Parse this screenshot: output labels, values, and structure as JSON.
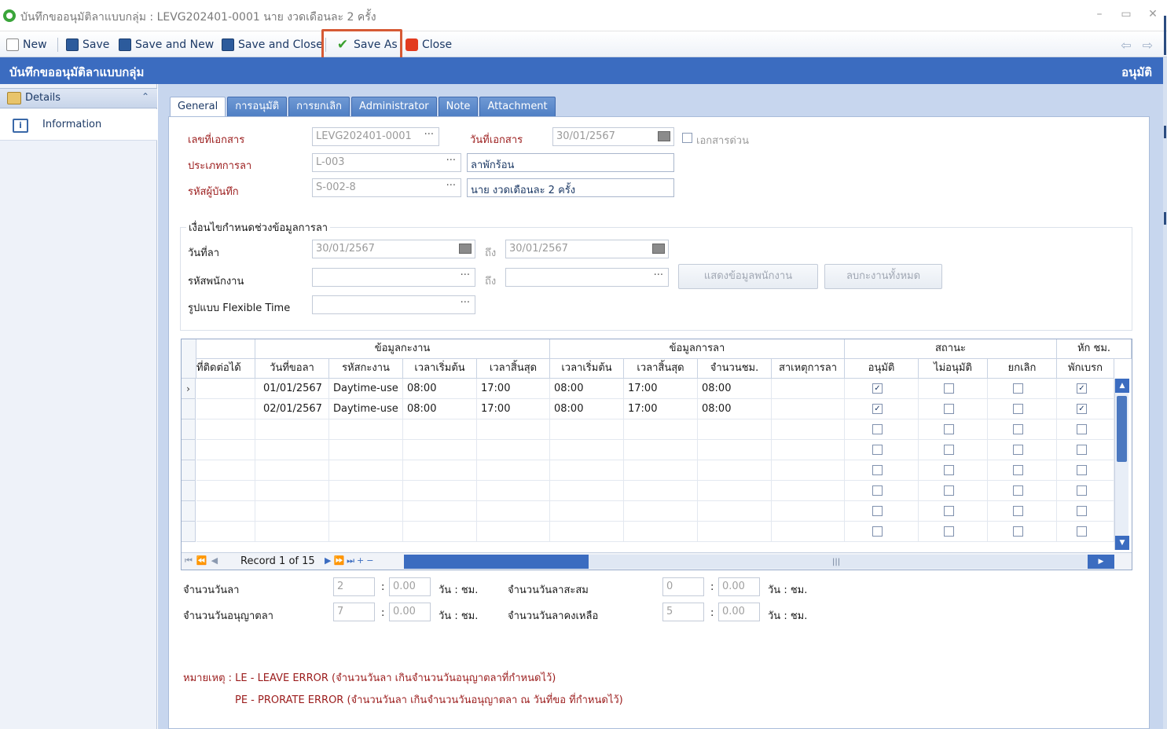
{
  "window": {
    "title": "บันทึกขออนุมัติลาแบบกลุ่ม : LEVG202401-0001 นาย งวดเดือนละ 2 ครั้ง",
    "controls": [
      "–",
      "▭",
      "✕"
    ]
  },
  "toolbar": {
    "new_label": "New",
    "save_label": "Save",
    "save_and_new_label": "Save and New",
    "save_and_close_label": "Save and Close",
    "save_as_label": "Save As",
    "close_label": "Close"
  },
  "header": {
    "title": "บันทึกขออนุมัติลาแบบกลุ่ม",
    "status": "อนุมัติ"
  },
  "sidebar": {
    "section_label": "Details",
    "items": [
      {
        "label": "Information"
      }
    ]
  },
  "tabs": [
    {
      "label": "General",
      "active": true
    },
    {
      "label": "การอนุมัติ"
    },
    {
      "label": "การยกเลิก"
    },
    {
      "label": "Administrator"
    },
    {
      "label": "Note"
    },
    {
      "label": "Attachment"
    }
  ],
  "form": {
    "doc_no_label": "เลขที่เอกสาร",
    "doc_no_value": "LEVG202401-0001",
    "doc_date_label": "วันที่เอกสาร",
    "doc_date_value": "30/01/2567",
    "urgent_label": "เอกสารด่วน",
    "leave_type_label": "ประเภทการลา",
    "leave_type_code": "L-003",
    "leave_type_name": "ลาพักร้อน",
    "recorder_label": "รหัสผู้บันทึก",
    "recorder_code": "S-002-8",
    "recorder_name": "นาย งวดเดือนละ 2 ครั้ง"
  },
  "criteria": {
    "group_title": "เงื่อนไขกำหนดช่วงข้อมูลการลา",
    "leave_date_label": "วันที่ลา",
    "leave_date_from": "30/01/2567",
    "to_label": "ถึง",
    "leave_date_to": "30/01/2567",
    "employee_label": "รหัสพนักงาน",
    "employee_from": "",
    "employee_to": "",
    "flex_label": "รูปแบบ Flexible Time",
    "flex_value": "",
    "show_btn": "แสดงข้อมูลพนักงาน",
    "clear_btn": "ลบกะงานทั้งหมด"
  },
  "grid": {
    "band_shift": "ข้อมูลกะงาน",
    "band_leave": "ข้อมูลการลา",
    "band_status": "สถานะ",
    "band_break": "หัก ชม.",
    "columns": [
      "ที่ติดต่อได้",
      "วันที่ขอลา",
      "รหัสกะงาน",
      "เวลาเริ่มต้น",
      "เวลาสิ้นสุด",
      "เวลาเริ่มต้น",
      "เวลาสิ้นสุด",
      "จำนวนชม.",
      "สาเหตุการลา",
      "อนุมัติ",
      "ไม่อนุมัติ",
      "ยกเลิก",
      "พักเบรก"
    ],
    "rows": [
      {
        "contact": "",
        "date": "01/01/2567",
        "shift": "Daytime-use",
        "shift_start": "08:00",
        "shift_end": "17:00",
        "leave_start": "08:00",
        "leave_end": "17:00",
        "hours": "08:00",
        "reason": "",
        "approve": true,
        "reject": false,
        "cancel": false,
        "break": true
      },
      {
        "contact": "",
        "date": "02/01/2567",
        "shift": "Daytime-use",
        "shift_start": "08:00",
        "shift_end": "17:00",
        "leave_start": "08:00",
        "leave_end": "17:00",
        "hours": "08:00",
        "reason": "",
        "approve": true,
        "reject": false,
        "cancel": false,
        "break": true
      }
    ],
    "empty_rows": 6,
    "record_text": "Record 1 of 15"
  },
  "summary": {
    "leave_days_label": "จำนวนวันลา",
    "leave_days": "2",
    "leave_hours": "0.00",
    "unit": "วัน : ชม.",
    "accum_label": "จำนวนวันลาสะสม",
    "accum_days": "0",
    "accum_hours": "0.00",
    "allowed_label": "จำนวนวันอนุญาตลา",
    "allowed_days": "7",
    "allowed_hours": "0.00",
    "remain_label": "จำนวนวันลาคงเหลือ",
    "remain_days": "5",
    "remain_hours": "0.00",
    "colon": ":"
  },
  "notes": {
    "line1": "หมายเหตุ : LE - LEAVE ERROR (จำนวนวันลา เกินจำนวนวันอนุญาตลาที่กำหนดไว้)",
    "line2": "PE - PRORATE ERROR (จำนวนวันลา เกินจำนวนวันอนุญาตลา ณ วันที่ขอ ที่กำหนดไว้)"
  },
  "colors": {
    "header_blue": "#3b6cc0",
    "label_red": "#9b1c1c",
    "highlight": "#d65a35"
  }
}
